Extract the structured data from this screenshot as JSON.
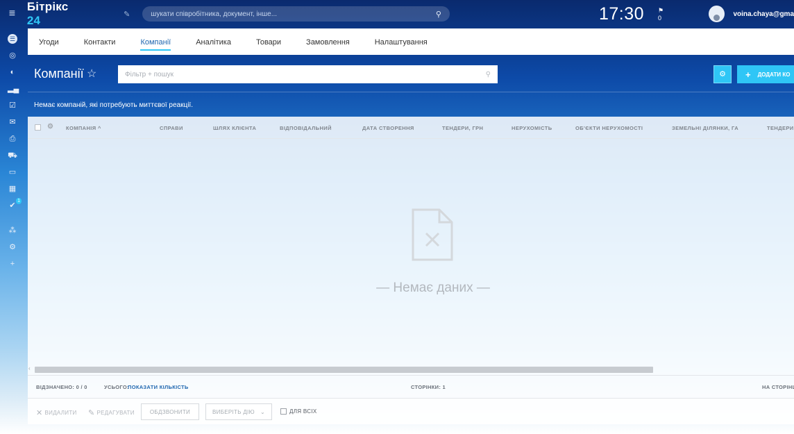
{
  "topbar": {
    "logo_text": "Бітрікс",
    "logo_num": "24",
    "search_placeholder": "шукати співробітника, документ, інше...",
    "clock": "17:30",
    "flag_count": "0",
    "user": "voina.chaya@gma"
  },
  "sidebar": {
    "icons": [
      "filter-icon",
      "target-icon",
      "circle-icon",
      "bar-chart-icon",
      "check-square-icon",
      "mail-icon",
      "print-icon",
      "cart-icon",
      "window-icon",
      "grid-icon",
      "checkmark-circle-icon",
      "network-icon",
      "gear-icon",
      "plus-icon"
    ],
    "badge": "1"
  },
  "tabs": [
    "Угоди",
    "Контакти",
    "Компанії",
    "Аналітика",
    "Товари",
    "Замовлення",
    "Налаштування"
  ],
  "active_tab": "Компанії",
  "header": {
    "title": "Компанії",
    "filter_placeholder": "Фільтр + пошук",
    "add_button": "ДОДАТИ КО",
    "notice": "Немає компаній, які потребують миттєвої реакції."
  },
  "grid": {
    "columns": [
      "КОМПАНІЯ ^",
      "СПРАВИ",
      "ШЛЯХ КЛІЄНТА",
      "ВІДПОВІДАЛЬНИЙ",
      "ДАТА СТВОРЕННЯ",
      "ТЕНДЕРИ, ГРН",
      "НЕРУХОМІСТЬ",
      "ОБ'ЄКТИ НЕРУХОМОСТІ",
      "ЗЕМЕЛЬНІ ДІЛЯНКИ, ГА",
      "ТЕНДЕРИ,"
    ],
    "empty_text": "— Немає даних —"
  },
  "footer": {
    "selected_label": "ВІДЗНАЧЕНО: 0 / 0",
    "total_label": "УСЬОГО:",
    "show_count": "ПОКАЗАТИ КІЛЬКІСТЬ",
    "pages": "СТОРІНКИ: 1",
    "per_page": "НА СТОРІНЦ"
  },
  "actions": {
    "delete": "ВИДАЛИТИ",
    "edit": "РЕДАГУВАТИ",
    "call": "ОБДЗВОНИТИ",
    "choose_action": "ВИБЕРІТЬ ДІЮ",
    "for_all": "ДЛЯ ВСІХ"
  },
  "colors": {
    "accent": "#2fc6f6",
    "link": "#2067b0"
  }
}
